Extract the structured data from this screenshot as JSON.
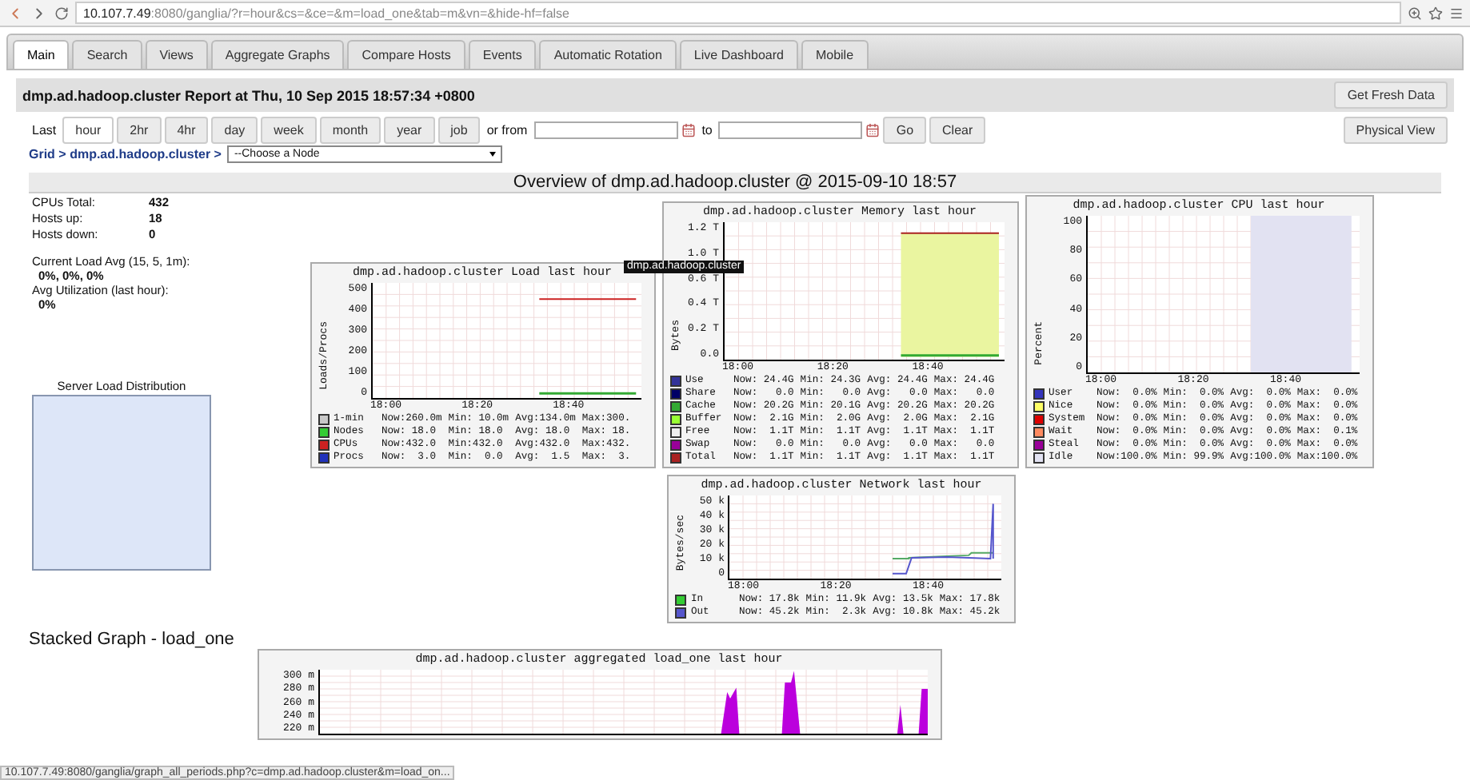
{
  "browser": {
    "url_host": "10.107.7.49",
    "url_rest": ":8080/ganglia/?r=hour&cs=&ce=&m=load_one&tab=m&vn=&hide-hf=false"
  },
  "tabs": [
    {
      "label": "Main",
      "selected": true
    },
    {
      "label": "Search",
      "selected": false
    },
    {
      "label": "Views",
      "selected": false
    },
    {
      "label": "Aggregate Graphs",
      "selected": false
    },
    {
      "label": "Compare Hosts",
      "selected": false
    },
    {
      "label": "Events",
      "selected": false
    },
    {
      "label": "Automatic Rotation",
      "selected": false
    },
    {
      "label": "Live Dashboard",
      "selected": false
    },
    {
      "label": "Mobile",
      "selected": false
    }
  ],
  "report": {
    "title": "dmp.ad.hadoop.cluster Report at Thu, 10 Sep 2015 18:57:34 +0800",
    "refresh_button": "Get Fresh Data"
  },
  "range": {
    "label": "Last",
    "options": [
      {
        "label": "hour",
        "selected": true
      },
      {
        "label": "2hr",
        "selected": false
      },
      {
        "label": "4hr",
        "selected": false
      },
      {
        "label": "day",
        "selected": false
      },
      {
        "label": "week",
        "selected": false
      },
      {
        "label": "month",
        "selected": false
      },
      {
        "label": "year",
        "selected": false
      },
      {
        "label": "job",
        "selected": false
      }
    ],
    "from_label": "or from",
    "to_label": "to",
    "go_button": "Go",
    "clear_button": "Clear",
    "physical_view_button": "Physical View"
  },
  "breadcrumb": "Grid > dmp.ad.hadoop.cluster >",
  "node_select": {
    "value": "--Choose a Node"
  },
  "overview_title": "Overview of dmp.ad.hadoop.cluster @ 2015-09-10 18:57",
  "stats": [
    {
      "label": "CPUs Total:",
      "value": "432"
    },
    {
      "label": "Hosts up:",
      "value": "18"
    },
    {
      "label": "Hosts down:",
      "value": "0"
    }
  ],
  "load_avg": {
    "label": "Current Load Avg (15, 5, 1m):",
    "value": "0%, 0%, 0%"
  },
  "utilization": {
    "label": "Avg Utilization (last hour):",
    "value": "0%"
  },
  "server_load": {
    "title": "Server Load Distribution"
  },
  "graphs": [
    {
      "kind": "load",
      "title": "dmp.ad.hadoop.cluster Load last hour",
      "ylabel": "Loads/Procs",
      "yticks": [
        "500",
        "400",
        "300",
        "200",
        "100",
        "0"
      ],
      "xticks": [
        "18:00",
        "18:20",
        "18:40"
      ],
      "legend": [
        {
          "label": "1-min",
          "color": "#c8c8c8",
          "values": [
            "Now:260.0m",
            "Min: 10.0m",
            "Avg:134.0m",
            "Max:300."
          ]
        },
        {
          "label": "Nodes",
          "color": "#33cc33",
          "values": [
            "Now: 18.0",
            "Min: 18.0",
            "Avg: 18.0",
            "Max: 18."
          ]
        },
        {
          "label": "CPUs",
          "color": "#cc2222",
          "values": [
            "Now:432.0",
            "Min:432.0",
            "Avg:432.0",
            "Max:432."
          ]
        },
        {
          "label": "Procs",
          "color": "#2233bb",
          "values": [
            "Now:  3.0",
            "Min:  0.0",
            "Avg:  1.5",
            "Max:  3."
          ]
        }
      ]
    },
    {
      "kind": "memory",
      "title": "dmp.ad.hadoop.cluster Memory last hour",
      "ylabel": "Bytes",
      "yticks": [
        "1.2 T",
        "1.0 T",
        "0.6 T",
        "0.4 T",
        "0.2 T",
        "0.0"
      ],
      "xticks": [
        "18:00",
        "18:20",
        "18:40"
      ],
      "legend": [
        {
          "label": "Use",
          "color": "#333399",
          "values": [
            "Now: 24.4G",
            "Min: 24.3G",
            "Avg: 24.4G",
            "Max: 24.4G"
          ]
        },
        {
          "label": "Share",
          "color": "#000066",
          "values": [
            "Now:   0.0",
            "Min:   0.0",
            "Avg:   0.0",
            "Max:   0.0"
          ]
        },
        {
          "label": "Cache",
          "color": "#33aa33",
          "values": [
            "Now: 20.2G",
            "Min: 20.1G",
            "Avg: 20.2G",
            "Max: 20.2G"
          ]
        },
        {
          "label": "Buffer",
          "color": "#99ff33",
          "values": [
            "Now:  2.1G",
            "Min:  2.0G",
            "Avg:  2.0G",
            "Max:  2.1G"
          ]
        },
        {
          "label": "Free",
          "color": "#eeeeee",
          "values": [
            "Now:  1.1T",
            "Min:  1.1T",
            "Avg:  1.1T",
            "Max:  1.1T"
          ]
        },
        {
          "label": "Swap",
          "color": "#990099",
          "values": [
            "Now:   0.0",
            "Min:   0.0",
            "Avg:   0.0",
            "Max:   0.0"
          ]
        },
        {
          "label": "Total",
          "color": "#aa2222",
          "values": [
            "Now:  1.1T",
            "Min:  1.1T",
            "Avg:  1.1T",
            "Max:  1.1T"
          ]
        }
      ]
    },
    {
      "kind": "cpu",
      "title": "dmp.ad.hadoop.cluster CPU last hour",
      "ylabel": "Percent",
      "yticks": [
        "100",
        "80",
        "60",
        "40",
        "20",
        "0"
      ],
      "xticks": [
        "18:00",
        "18:20",
        "18:40"
      ],
      "legend": [
        {
          "label": "User",
          "color": "#3333bb",
          "values": [
            "Now:  0.0%",
            "Min:  0.0%",
            "Avg:  0.0%",
            "Max:  0.0%"
          ]
        },
        {
          "label": "Nice",
          "color": "#ffff66",
          "values": [
            "Now:  0.0%",
            "Min:  0.0%",
            "Avg:  0.0%",
            "Max:  0.0%"
          ]
        },
        {
          "label": "System",
          "color": "#dd0000",
          "values": [
            "Now:  0.0%",
            "Min:  0.0%",
            "Avg:  0.0%",
            "Max:  0.0%"
          ]
        },
        {
          "label": "Wait",
          "color": "#ff8a60",
          "values": [
            "Now:  0.0%",
            "Min:  0.0%",
            "Avg:  0.0%",
            "Max:  0.1%"
          ]
        },
        {
          "label": "Steal",
          "color": "#990099",
          "values": [
            "Now:  0.0%",
            "Min:  0.0%",
            "Avg:  0.0%",
            "Max:  0.0%"
          ]
        },
        {
          "label": "Idle",
          "color": "#e2e2f2",
          "values": [
            "Now:100.0%",
            "Min: 99.9%",
            "Avg:100.0%",
            "Max:100.0%"
          ]
        }
      ]
    },
    {
      "kind": "network",
      "title": "dmp.ad.hadoop.cluster Network last hour",
      "ylabel": "Bytes/sec",
      "yticks": [
        "50 k",
        "40 k",
        "30 k",
        "20 k",
        "10 k",
        "0"
      ],
      "xticks": [
        "18:00",
        "18:20",
        "18:40"
      ],
      "legend": [
        {
          "label": "In",
          "color": "#33cc33",
          "values": [
            "Now: 17.8k",
            "Min: 11.9k",
            "Avg: 13.5k",
            "Max: 17.8k"
          ]
        },
        {
          "label": "Out",
          "color": "#5555cc",
          "values": [
            "Now: 45.2k",
            "Min:  2.3k",
            "Avg: 10.8k",
            "Max: 45.2k"
          ]
        }
      ]
    }
  ],
  "stacked": {
    "heading": "Stacked Graph - load_one",
    "graph": {
      "kind": "stacked",
      "title": "dmp.ad.hadoop.cluster aggregated load_one last hour",
      "yticks": [
        "300 m",
        "280 m",
        "260 m",
        "240 m",
        "220 m"
      ]
    }
  },
  "tooltip": "dmp.ad.hadoop.cluster",
  "status_url": "10.107.7.49:8080/ganglia/graph_all_periods.php?c=dmp.ad.hadoop.cluster&m=load_on..."
}
